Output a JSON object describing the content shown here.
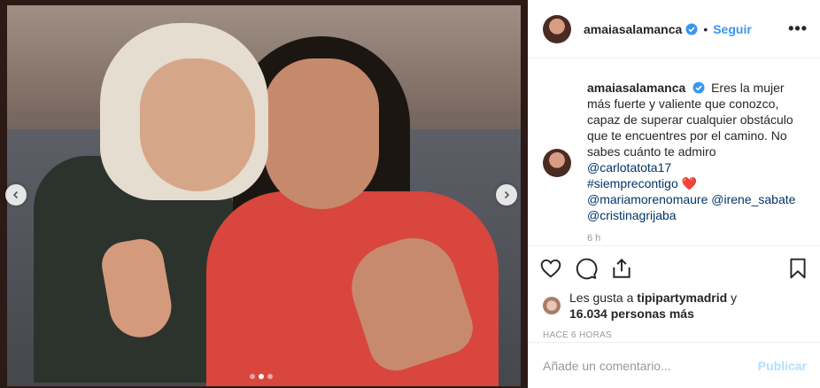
{
  "post": {
    "username": "amaiasalamanca",
    "follow_label": "Seguir",
    "separator": "•",
    "more_label": "•••"
  },
  "caption": {
    "username": "amaiasalamanca",
    "text": "Eres la mujer más fuerte y valiente que conozco, capaz de superar cualquier obstáculo que te encuentres por el camino. No sabes cuánto te admiro",
    "mention_1": "@carlotatota17",
    "hashtag": "#siemprecontigo",
    "heart": "❤️",
    "mentions_2": "@mariamorenomaure @irene_sabate",
    "mention_3": "@cristinagrijaba",
    "time_ago": "6 h"
  },
  "likes": {
    "prefix": "Les gusta a",
    "user": "tipipartymadrid",
    "conjunction": "y",
    "others": "16.034 personas más"
  },
  "posted": "HACE 6 HORAS",
  "comment_box": {
    "placeholder": "Añade un comentario...",
    "publish_label": "Publicar"
  },
  "carousel": {
    "total": 3,
    "active": 2
  },
  "colors": {
    "link": "#3897f0",
    "publish_disabled": "#b2dffc",
    "verified": "#3897f0",
    "heart": "#ed4956"
  },
  "icons": [
    "verified-badge-icon",
    "heart-icon",
    "comment-icon",
    "share-icon",
    "bookmark-icon",
    "chevron-left-icon",
    "chevron-right-icon"
  ]
}
